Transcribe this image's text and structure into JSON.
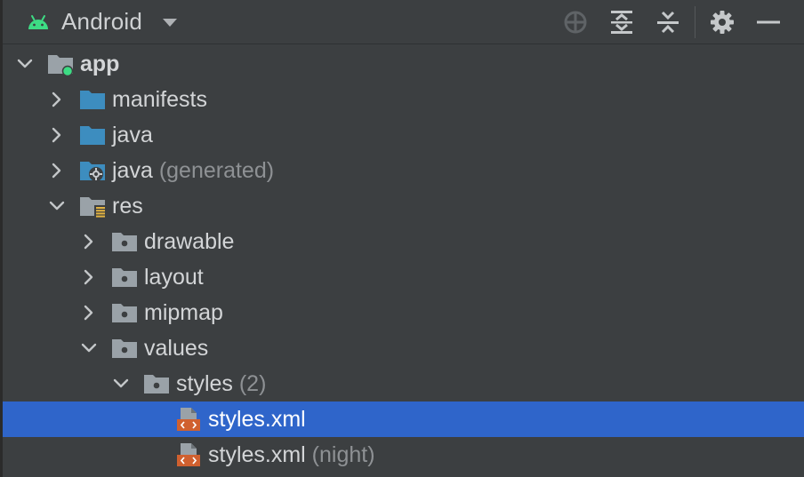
{
  "header": {
    "view_label": "Android",
    "icons": [
      "android-icon",
      "dropdown-caret-icon",
      "locate-icon",
      "expand-all-icon",
      "collapse-all-icon",
      "gear-icon",
      "hide-icon"
    ]
  },
  "tree": [
    {
      "label": "app",
      "suffix": "",
      "expanded": true,
      "icon": "module-folder-icon"
    },
    {
      "label": "manifests",
      "suffix": "",
      "expanded": false,
      "icon": "folder-icon"
    },
    {
      "label": "java",
      "suffix": "",
      "expanded": false,
      "icon": "folder-icon"
    },
    {
      "label": "java",
      "suffix": "(generated)",
      "expanded": false,
      "icon": "generated-folder-icon"
    },
    {
      "label": "res",
      "suffix": "",
      "expanded": true,
      "icon": "resources-folder-icon"
    },
    {
      "label": "drawable",
      "suffix": "",
      "expanded": false,
      "icon": "folder-icon"
    },
    {
      "label": "layout",
      "suffix": "",
      "expanded": false,
      "icon": "folder-icon"
    },
    {
      "label": "mipmap",
      "suffix": "",
      "expanded": false,
      "icon": "folder-icon"
    },
    {
      "label": "values",
      "suffix": "",
      "expanded": true,
      "icon": "folder-icon"
    },
    {
      "label": "styles",
      "suffix": "(2)",
      "expanded": true,
      "icon": "folder-icon"
    },
    {
      "label": "styles.xml",
      "suffix": "",
      "selected": true,
      "icon": "xml-file-icon"
    },
    {
      "label": "styles.xml",
      "suffix": "(night)",
      "icon": "xml-file-icon"
    }
  ],
  "colors": {
    "background": "#3c3f41",
    "selection": "#2f65ca",
    "folder_blue": "#3d8dbf",
    "folder_grey": "#9aa2a8",
    "android_green": "#3ddc84",
    "xml_orange": "#d0602f"
  }
}
